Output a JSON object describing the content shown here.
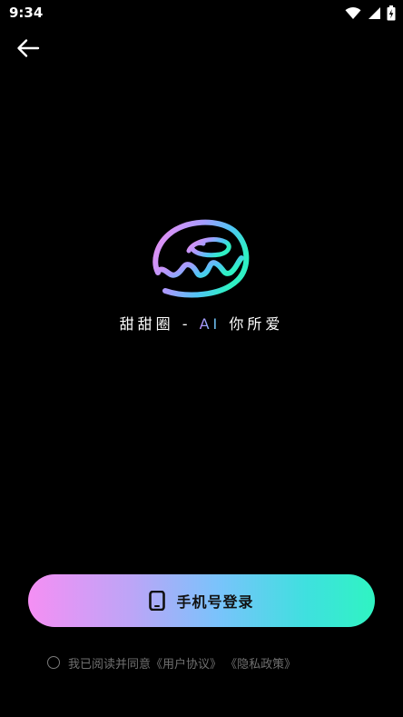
{
  "status_bar": {
    "time": "9:34"
  },
  "icons": {
    "back": "back-arrow-icon",
    "wifi": "wifi-icon",
    "signal": "signal-icon",
    "battery": "battery-charging-icon",
    "phone": "phone-icon",
    "logo": "donut-logo-icon"
  },
  "brand": {
    "slogan_prefix": "甜甜圈 - ",
    "slogan_ai": "AI",
    "slogan_suffix": " 你所爱"
  },
  "login": {
    "button_label": "手机号登录"
  },
  "agreement": {
    "text": "我已阅读并同意",
    "user_agreement": "《用户协议》",
    "privacy_policy": "《隐私政策》"
  },
  "colors": {
    "background": "#000000",
    "gradient_start": "#f58ff4",
    "gradient_end": "#2ff4c2",
    "muted_text": "#6f6f6f"
  }
}
